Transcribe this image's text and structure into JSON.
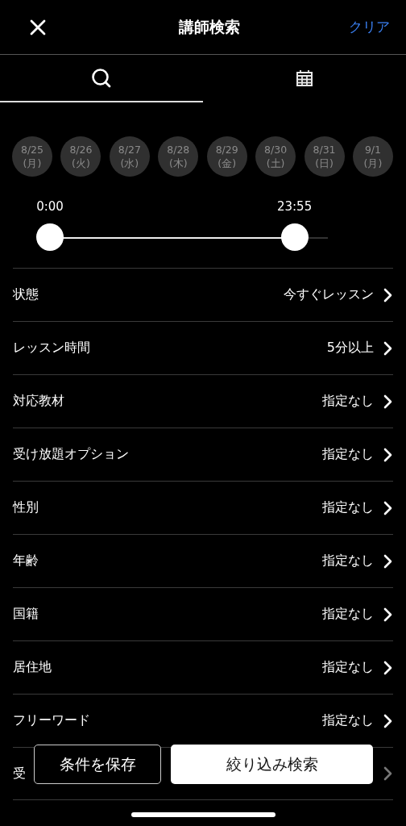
{
  "header": {
    "title": "講師検索",
    "clear": "クリア"
  },
  "tabs": [
    {
      "kind": "search",
      "selected": true
    },
    {
      "kind": "calendar",
      "selected": false
    }
  ],
  "dates": [
    {
      "date": "8/25",
      "weekday": "(月)"
    },
    {
      "date": "8/26",
      "weekday": "(火)"
    },
    {
      "date": "8/27",
      "weekday": "(水)"
    },
    {
      "date": "8/28",
      "weekday": "(木)"
    },
    {
      "date": "8/29",
      "weekday": "(金)"
    },
    {
      "date": "8/30",
      "weekday": "(土)"
    },
    {
      "date": "8/31",
      "weekday": "(日)"
    },
    {
      "date": "9/1",
      "weekday": "(月)"
    }
  ],
  "time_range": {
    "start": "0:00",
    "end": "23:55",
    "thumbs": [
      {
        "level": 0
      },
      {
        "level": 0.88
      }
    ]
  },
  "filters": [
    {
      "label": "状態",
      "value": "今すぐレッスン"
    },
    {
      "label": "レッスン時間",
      "value": "5分以上"
    },
    {
      "label": "対応教材",
      "value": "指定なし"
    },
    {
      "label": "受け放題オプション",
      "value": "指定なし"
    },
    {
      "label": "性別",
      "value": "指定なし"
    },
    {
      "label": "年齢",
      "value": "指定なし"
    },
    {
      "label": "国籍",
      "value": "指定なし"
    },
    {
      "label": "居住地",
      "value": "指定なし"
    },
    {
      "label": "フリーワード",
      "value": "指定なし"
    },
    {
      "label": "受"
    }
  ],
  "buttons": {
    "save": "条件を保存",
    "search": "絞り込み検索"
  }
}
